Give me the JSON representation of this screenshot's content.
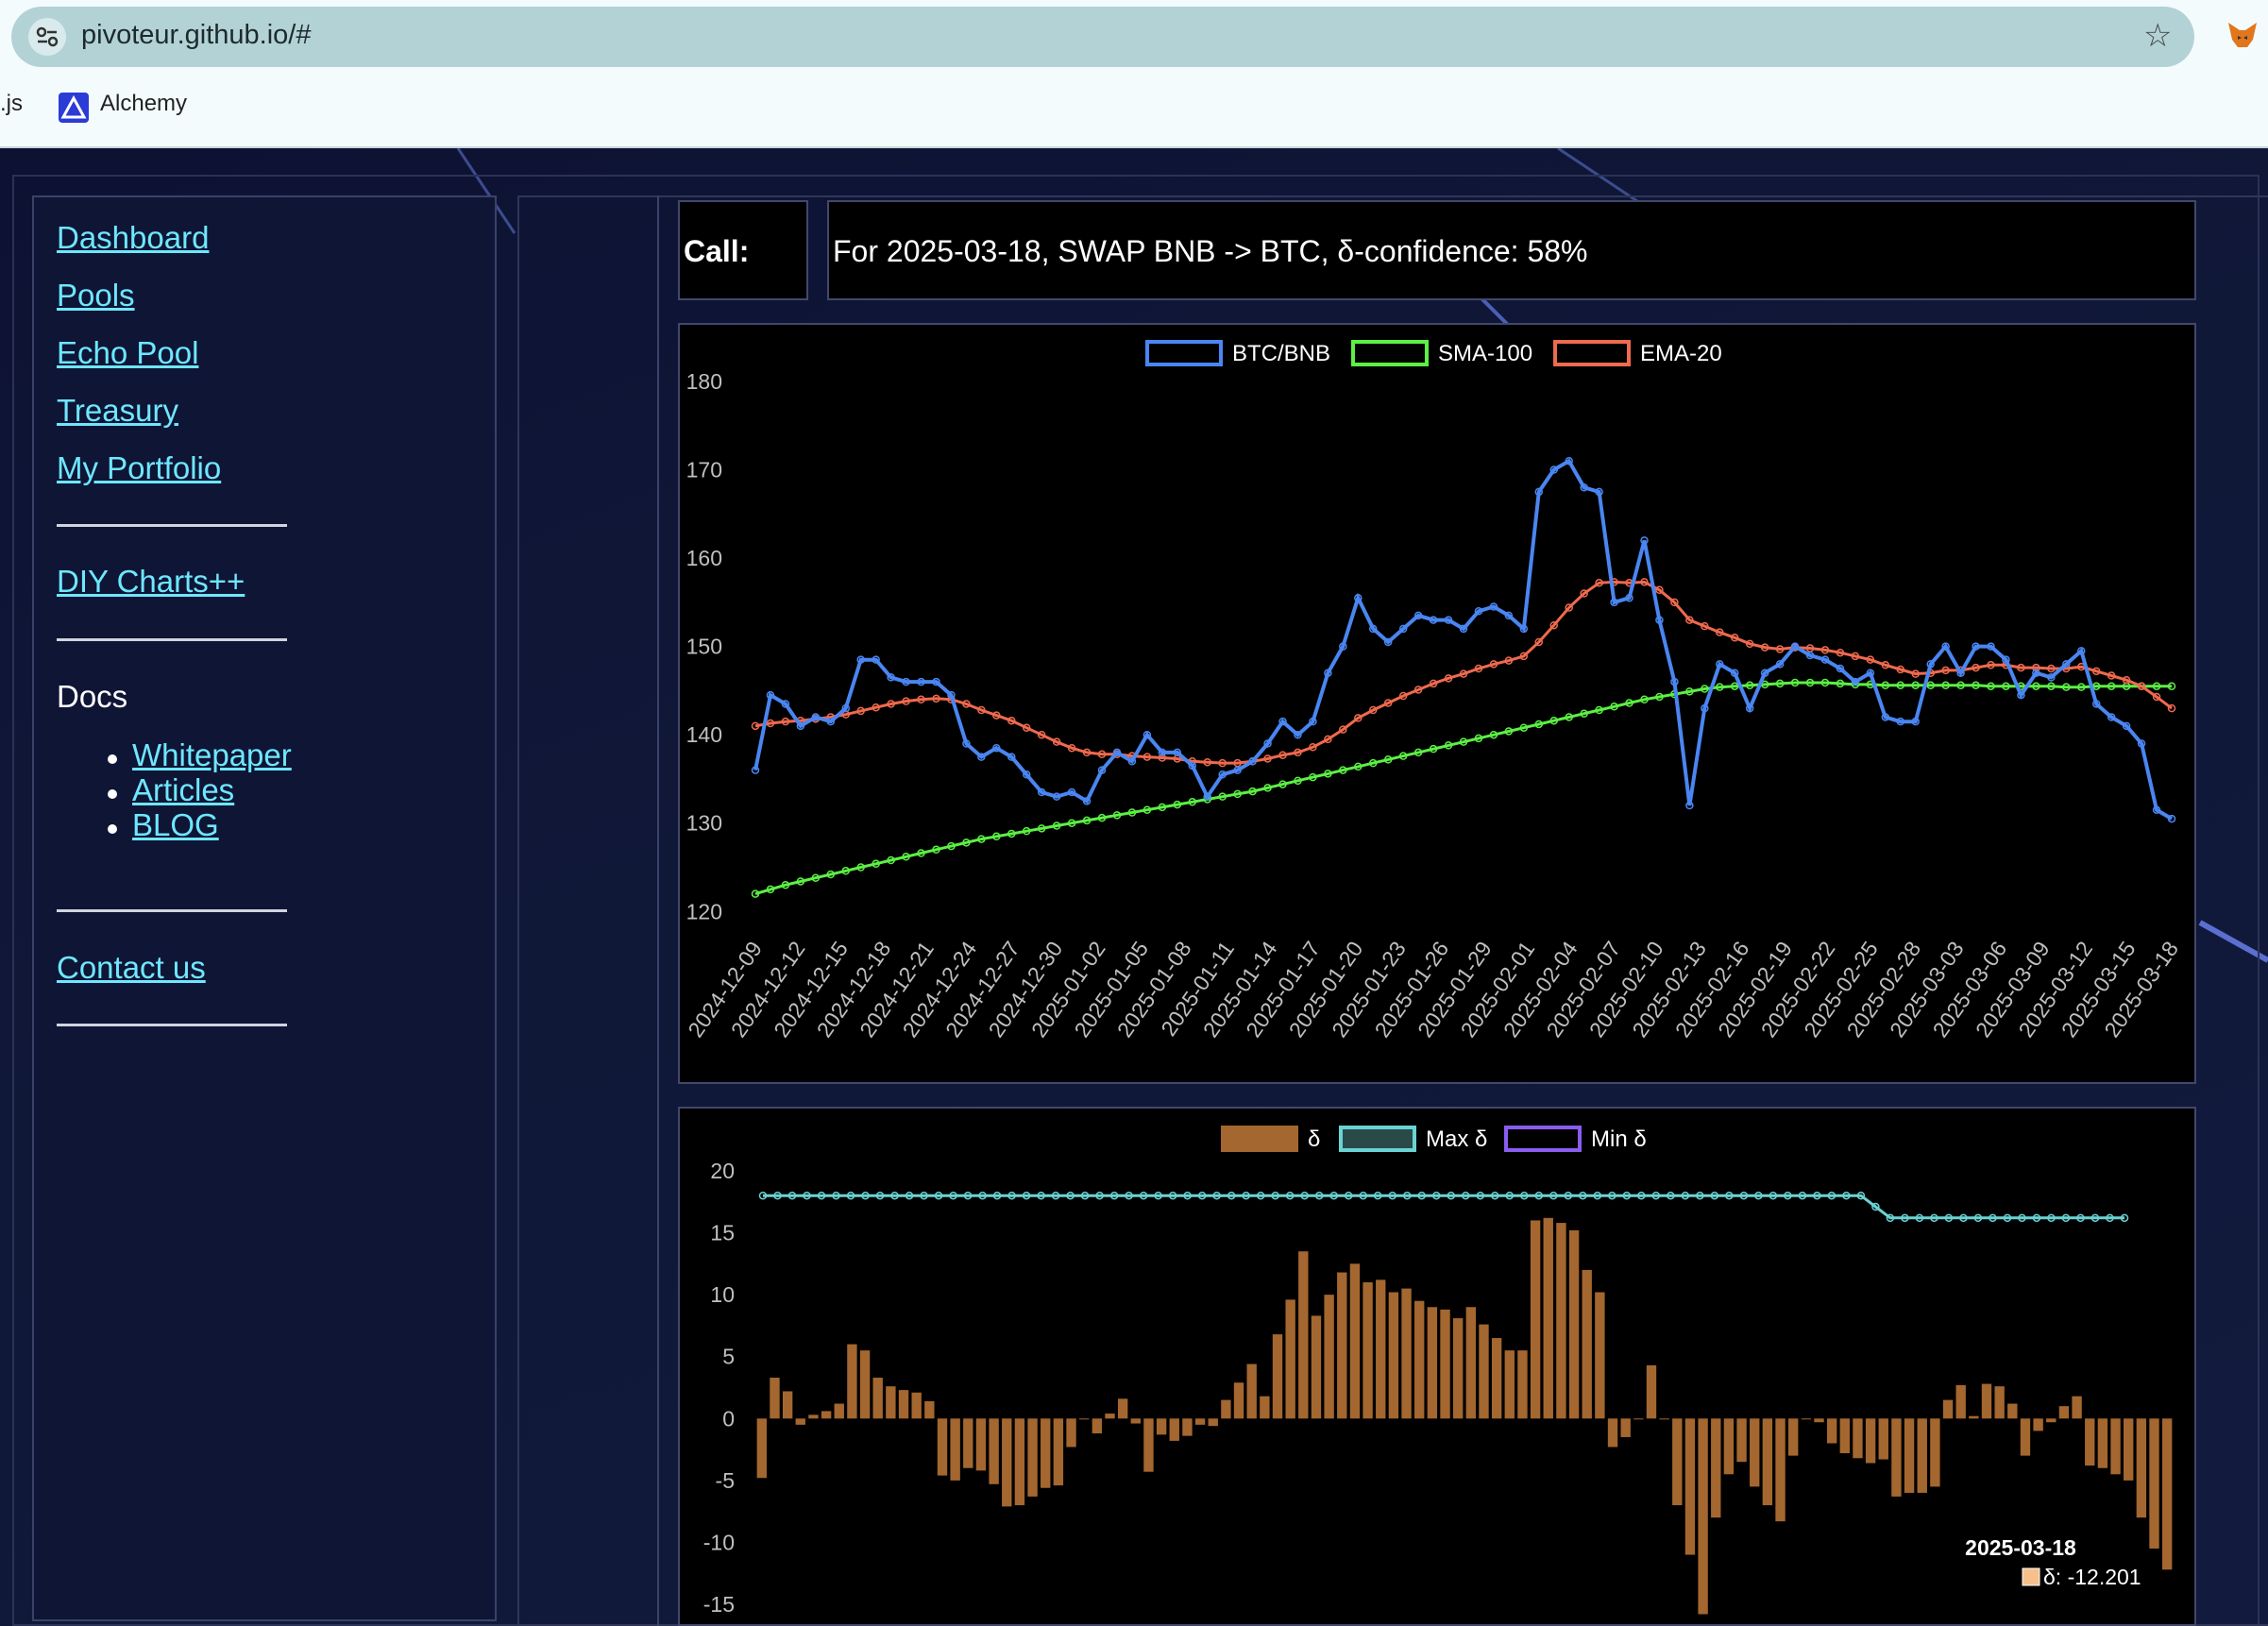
{
  "browser": {
    "url": "pivoteur.github.io/#",
    "bookmarks": [
      ".js",
      "Alchemy"
    ]
  },
  "sidebar": {
    "links": [
      "Dashboard",
      "Pools",
      "Echo Pool",
      "Treasury",
      "My Portfolio"
    ],
    "diy": "DIY Charts++",
    "docs_label": "Docs",
    "docs_links": [
      "Whitepaper",
      "Articles",
      "BLOG"
    ],
    "contact": "Contact us"
  },
  "call": {
    "label": "Call:",
    "text": "For 2025-03-18, SWAP BNB -> BTC, δ-confidence: 58%"
  },
  "colors": {
    "btc_bnb": "#4a86f2",
    "sma": "#5cf044",
    "ema": "#ef6a4e",
    "delta_bar": "#a4672f",
    "max_delta": "#6ad3d3",
    "min_delta": "#8a5cf0",
    "link": "#6ee7ff"
  },
  "chart_data": [
    {
      "type": "line",
      "legend": [
        "BTC/BNB",
        "SMA-100",
        "EMA-20"
      ],
      "legend_position": "top-center",
      "ylim": [
        118,
        180
      ],
      "yticks": [
        120,
        130,
        140,
        150,
        160,
        170,
        180
      ],
      "x_start": "2024-12-09",
      "x_end": "2025-03-18",
      "xtick_labels": [
        "2024-12-09",
        "2024-12-12",
        "2024-12-15",
        "2024-12-18",
        "2024-12-21",
        "2024-12-24",
        "2024-12-27",
        "2024-12-30",
        "2025-01-02",
        "2025-01-05",
        "2025-01-08",
        "2025-01-11",
        "2025-01-14",
        "2025-01-17",
        "2025-01-20",
        "2025-01-23",
        "2025-01-26",
        "2025-01-29",
        "2025-02-01",
        "2025-02-04",
        "2025-02-07",
        "2025-02-10",
        "2025-02-13",
        "2025-02-16",
        "2025-02-19",
        "2025-02-22",
        "2025-02-25",
        "2025-02-28",
        "2025-03-03",
        "2025-03-06",
        "2025-03-09",
        "2025-03-12",
        "2025-03-15",
        "2025-03-18"
      ],
      "series": [
        {
          "name": "BTC/BNB",
          "values": [
            136,
            144.5,
            143.5,
            141,
            142,
            141.5,
            143,
            148.5,
            148.5,
            146.5,
            146,
            146,
            146,
            144.5,
            139,
            137.5,
            138.5,
            137.5,
            135.5,
            133.5,
            133,
            133.5,
            132.5,
            136,
            138,
            137,
            140,
            138,
            138,
            136.5,
            133,
            135.5,
            136,
            137,
            139,
            141.5,
            140,
            141.5,
            147,
            150,
            155.5,
            152,
            150.5,
            152,
            153.5,
            153,
            153,
            152,
            154,
            154.5,
            153.5,
            152,
            167.5,
            170,
            171,
            168,
            167.5,
            155,
            155.5,
            162,
            153,
            146,
            132,
            143,
            148,
            147,
            143,
            147,
            148,
            150,
            149,
            148.5,
            147.5,
            146,
            147,
            142,
            141.5,
            141.5,
            148,
            150,
            147,
            150,
            150,
            148.5,
            144.5,
            147,
            146.5,
            148,
            149.5,
            143.5,
            142,
            141,
            139,
            131.5,
            130.5
          ]
        },
        {
          "name": "SMA-100",
          "values": [
            122,
            122.5,
            123,
            123.4,
            123.8,
            124.2,
            124.6,
            125,
            125.4,
            125.8,
            126.2,
            126.6,
            127,
            127.4,
            127.8,
            128.2,
            128.5,
            128.8,
            129.1,
            129.4,
            129.7,
            130,
            130.3,
            130.6,
            130.9,
            131.2,
            131.5,
            131.8,
            132.1,
            132.4,
            132.7,
            133,
            133.3,
            133.6,
            134,
            134.4,
            134.8,
            135.2,
            135.6,
            136,
            136.4,
            136.8,
            137.2,
            137.6,
            138,
            138.4,
            138.8,
            139.2,
            139.6,
            140,
            140.4,
            140.8,
            141.2,
            141.6,
            142,
            142.4,
            142.8,
            143.2,
            143.6,
            144,
            144.3,
            144.6,
            144.9,
            145.2,
            145.4,
            145.5,
            145.6,
            145.7,
            145.8,
            145.9,
            145.9,
            145.9,
            145.8,
            145.7,
            145.7,
            145.6,
            145.6,
            145.6,
            145.6,
            145.6,
            145.6,
            145.6,
            145.5,
            145.5,
            145.5,
            145.5,
            145.5,
            145.4,
            145.4,
            145.5,
            145.5,
            145.5,
            145.5,
            145.5,
            145.5
          ]
        },
        {
          "name": "EMA-20",
          "values": [
            141,
            141.3,
            141.5,
            141.6,
            141.8,
            142,
            142.3,
            142.7,
            143.1,
            143.5,
            143.8,
            144,
            144.1,
            144,
            143.5,
            142.8,
            142.2,
            141.6,
            140.8,
            140,
            139.2,
            138.5,
            138,
            137.8,
            137.8,
            137.6,
            137.5,
            137.4,
            137.3,
            137,
            136.9,
            136.8,
            136.8,
            137,
            137.3,
            137.7,
            138,
            138.6,
            139.5,
            140.6,
            141.9,
            142.8,
            143.6,
            144.4,
            145.1,
            145.8,
            146.4,
            146.9,
            147.5,
            148,
            148.4,
            148.9,
            150.5,
            152.4,
            154.4,
            156,
            157.2,
            157.3,
            157.2,
            157.3,
            156.4,
            155,
            153,
            152.3,
            151.6,
            151,
            150.3,
            149.9,
            149.7,
            149.9,
            149.8,
            149.6,
            149.3,
            148.9,
            148.5,
            147.9,
            147.4,
            146.9,
            147,
            147.3,
            147.3,
            147.6,
            147.9,
            147.9,
            147.6,
            147.6,
            147.5,
            147.5,
            147.7,
            147.2,
            146.7,
            146.2,
            145.5,
            144.3,
            143
          ]
        }
      ]
    },
    {
      "type": "bar",
      "legend": [
        "δ",
        "Max δ",
        "Min δ"
      ],
      "legend_position": "top-center",
      "ylim": [
        -16,
        20
      ],
      "yticks": [
        20,
        15,
        10,
        5,
        0,
        -5,
        -10,
        -15
      ],
      "series": [
        {
          "name": "δ",
          "values": [
            -4.8,
            3.3,
            2.2,
            -0.5,
            0.3,
            0.6,
            1.2,
            6,
            5.5,
            3.3,
            2.6,
            2.3,
            2.1,
            1.4,
            -4.6,
            -5,
            -4,
            -4.2,
            -5.3,
            -7.1,
            -7,
            -6.3,
            -5.6,
            -5.4,
            -2.3,
            0,
            -1.2,
            0.4,
            1.6,
            -0.4,
            -4.3,
            -1.3,
            -1.8,
            -1.4,
            -0.5,
            -0.6,
            1.5,
            2.9,
            4.4,
            1.8,
            6.8,
            9.6,
            13.5,
            8.3,
            10,
            11.8,
            12.5,
            11,
            11.2,
            10.2,
            10.5,
            9.5,
            9,
            8.8,
            8.1,
            9,
            7.6,
            6.5,
            5.5,
            5.5,
            16,
            16.2,
            15.8,
            15.2,
            12,
            10.2,
            -2.3,
            -1.5,
            0,
            4.3,
            0,
            -7,
            -11,
            -15.8,
            -8,
            -4.5,
            -3.5,
            -5.5,
            -7,
            -8.3,
            -3,
            0,
            -0.3,
            -2,
            -2.8,
            -3.2,
            -3.6,
            -3.3,
            -6.3,
            -6,
            -6,
            -5.5,
            1.5,
            2.7,
            0.2,
            2.8,
            2.6,
            1.2,
            -3,
            -1,
            -0.3,
            1,
            1.8,
            -3.8,
            -4,
            -4.5,
            -5,
            -8,
            -10.5,
            -12.2
          ]
        },
        {
          "name": "Max δ",
          "values_start": 18,
          "values_end": 16.2,
          "step_date": "2025-03-03"
        },
        {
          "name": "Min δ",
          "values": []
        }
      ],
      "tooltip": {
        "title": "2025-03-18",
        "label": "δ: -12.201"
      }
    }
  ]
}
